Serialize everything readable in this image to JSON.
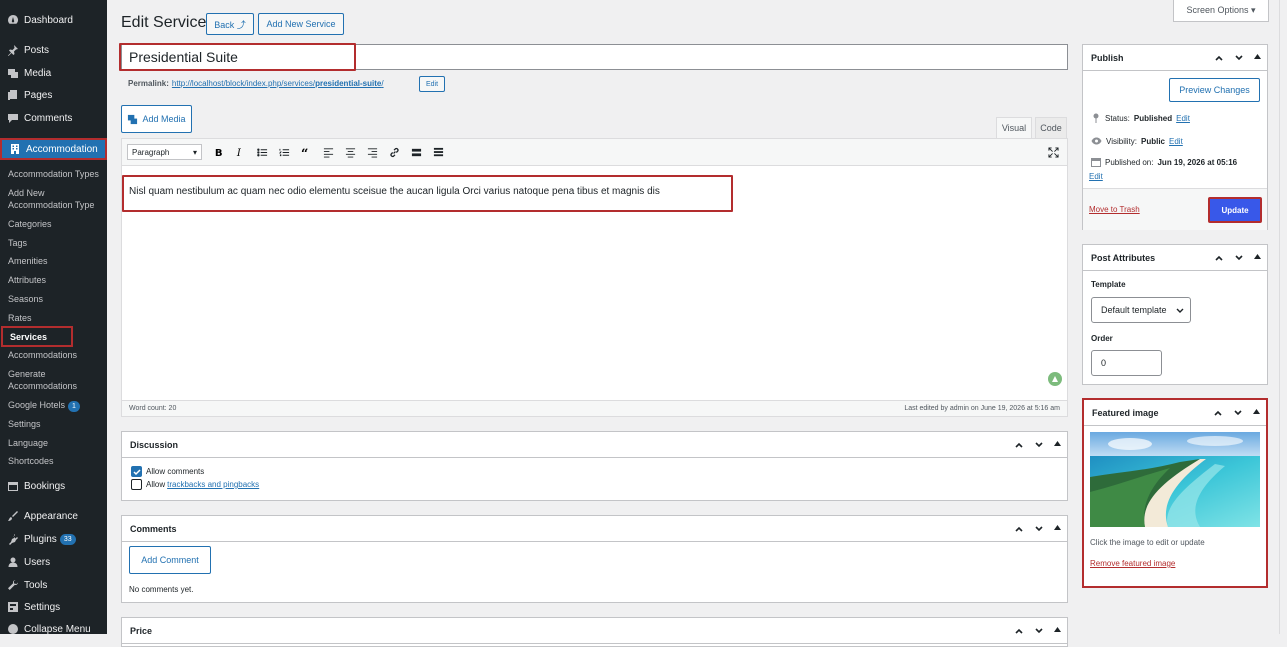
{
  "menu": {
    "top": [
      {
        "label": "Dashboard",
        "icon": "dashboard-icon"
      },
      {
        "label": "Posts",
        "icon": "pin-icon"
      },
      {
        "label": "Media",
        "icon": "media-icon"
      },
      {
        "label": "Pages",
        "icon": "page-icon"
      },
      {
        "label": "Comments",
        "icon": "comment-icon"
      }
    ],
    "active": {
      "label": "Accommodation",
      "icon": "building-icon"
    },
    "sub": [
      "Accommodation Types",
      "Add New Accommodation Type",
      "Categories",
      "Tags",
      "Amenities",
      "Attributes",
      "Seasons",
      "Rates",
      "Services",
      "Accommodations",
      "Generate Accommodations",
      "Google Hotels",
      "Settings",
      "Language",
      "Shortcodes"
    ],
    "google_hotels_badge": "1",
    "bottom": [
      {
        "label": "Bookings",
        "icon": "calendar-icon"
      },
      {
        "label": "Appearance",
        "icon": "brush-icon"
      },
      {
        "label": "Plugins",
        "icon": "plugin-icon"
      },
      {
        "label": "Users",
        "icon": "users-icon"
      },
      {
        "label": "Tools",
        "icon": "wrench-icon"
      },
      {
        "label": "Settings",
        "icon": "settings-icon"
      },
      {
        "label": "Collapse Menu",
        "icon": "collapse-icon"
      }
    ],
    "plugins_badge": "33"
  },
  "header": {
    "title": "Edit Service",
    "back": "Back ⤴",
    "add_new": "Add New Service",
    "screen_options": "Screen Options ▾"
  },
  "post": {
    "title": "Presidential Suite",
    "permalink_label": "Permalink:",
    "permalink_base": "http://localhost/block/index.php/services/",
    "permalink_slug": "presidential-suite",
    "permalink_slash": "/",
    "permalink_edit": "Edit"
  },
  "editor": {
    "add_media": "Add Media",
    "tab_visual": "Visual",
    "tab_code": "Code",
    "format": "Paragraph",
    "content": "Nisl quam nestibulum ac quam nec odio elementu sceisue the aucan ligula Orci varius natoque pena tibus et magnis dis",
    "word_count": "Word count: 20",
    "last_edited": "Last edited by admin on June 19, 2026 at 5:16 am"
  },
  "discussion": {
    "title": "Discussion",
    "allow_comments": "Allow comments",
    "allow_prefix": "Allow",
    "trackbacks": "trackbacks and pingbacks"
  },
  "comments": {
    "title": "Comments",
    "add": "Add Comment",
    "none": "No comments yet."
  },
  "price": {
    "title": "Price"
  },
  "publish": {
    "title": "Publish",
    "preview": "Preview Changes",
    "status_label": "Status:",
    "status": "Published",
    "visibility_label": "Visibility:",
    "visibility": "Public",
    "published_label": "Published on:",
    "published": "Jun 19, 2026 at 05:16",
    "edit": "Edit",
    "trash": "Move to Trash",
    "update": "Update"
  },
  "attributes": {
    "title": "Post Attributes",
    "template_label": "Template",
    "template": "Default template",
    "order_label": "Order",
    "order": "0"
  },
  "featured": {
    "title": "Featured image",
    "hint": "Click the image to edit or update",
    "remove": "Remove featured image"
  },
  "colors": {
    "accent": "#2271b1",
    "menu_bg": "#1d2327",
    "highlight": "#b32d2e",
    "update_btn": "#3858e9"
  }
}
